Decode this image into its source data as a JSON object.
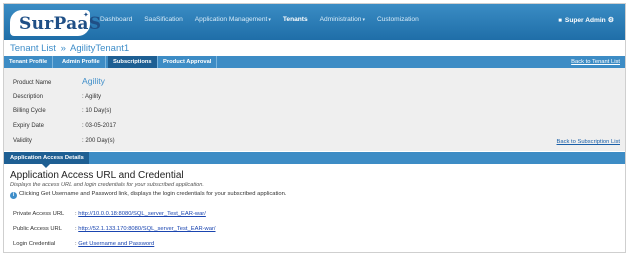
{
  "header": {
    "logo": "SurPaaS",
    "nav": [
      {
        "label": "Dashboard",
        "active": false,
        "dropdown": false
      },
      {
        "label": "SaaSification",
        "active": false,
        "dropdown": false
      },
      {
        "label": "Application Management",
        "active": false,
        "dropdown": true
      },
      {
        "label": "Tenants",
        "active": true,
        "dropdown": false
      },
      {
        "label": "Administration",
        "active": false,
        "dropdown": true
      },
      {
        "label": "Customization",
        "active": false,
        "dropdown": false
      }
    ],
    "user": "Super Admin"
  },
  "breadcrumb": {
    "root": "Tenant List",
    "separator": "»",
    "current": "AgilityTenant1"
  },
  "tabs": [
    {
      "label": "Tenant Profile",
      "active": false
    },
    {
      "label": "Admin Profile",
      "active": false
    },
    {
      "label": "Subscriptions",
      "active": true
    },
    {
      "label": "Product Approval",
      "active": false
    }
  ],
  "back_to_tenant_list": "Back to Tenant List",
  "details": {
    "product_name": {
      "label": "Product Name",
      "value": "Agility"
    },
    "description": {
      "label": "Description",
      "value": ": Agility"
    },
    "billing_cycle": {
      "label": "Billing Cycle",
      "value": ": 10 Day(s)"
    },
    "expiry_date": {
      "label": "Expiry Date",
      "value": ": 03-05-2017"
    },
    "validity": {
      "label": "Validity",
      "value": ": 200 Day(s)"
    }
  },
  "back_to_subscription_list": "Back to Subscription List",
  "access_tab": "Application Access Details",
  "access": {
    "title": "Application Access URL and Credential",
    "subtitle": "Displays the access URL and login credentials for your subscribed application.",
    "info": "Clicking Get Username and Password link, displays the login credentials for your subscribed application.",
    "private_url": {
      "label": "Private Access URL",
      "prefix": ": ",
      "value": "http://10.0.0.18:8080/SQL_server_Test_EAR-war/"
    },
    "public_url": {
      "label": "Public Access URL",
      "prefix": ": ",
      "value": "http://52.1.133.170:8080/SQL_server_Test_EAR-war/"
    },
    "login": {
      "label": "Login Credential",
      "prefix": ": ",
      "value": "Get Username and Password"
    }
  }
}
